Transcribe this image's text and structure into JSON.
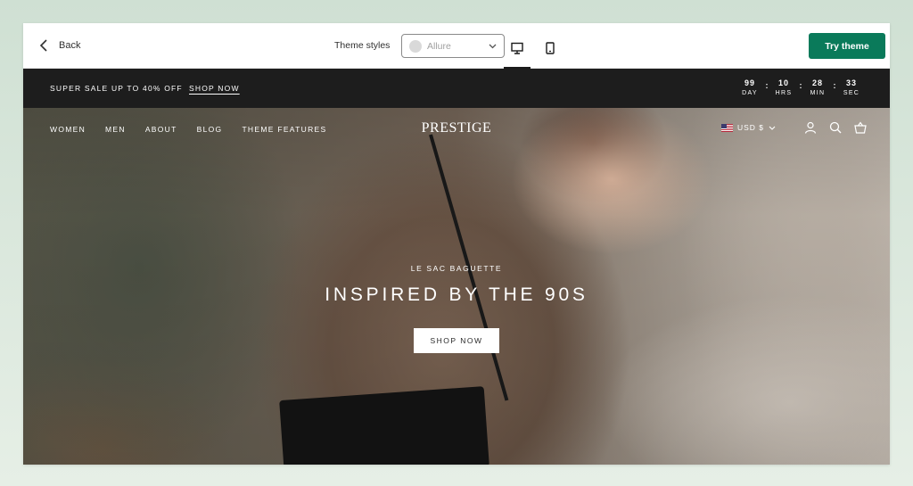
{
  "editor": {
    "back_label": "Back",
    "theme_styles_label": "Theme styles",
    "theme_style_value": "Allure",
    "try_theme_label": "Try theme",
    "accent_color": "#0a7a5a"
  },
  "announcement": {
    "text": "SUPER SALE UP TO 40% OFF",
    "link": "SHOP NOW",
    "countdown": [
      {
        "value": "99",
        "label": "DAY"
      },
      {
        "value": "10",
        "label": "HRS"
      },
      {
        "value": "28",
        "label": "MIN"
      },
      {
        "value": "33",
        "label": "SEC"
      }
    ]
  },
  "store_nav": {
    "items": [
      "WOMEN",
      "MEN",
      "ABOUT",
      "BLOG",
      "THEME FEATURES"
    ],
    "logo": "PRESTIGE",
    "currency": "USD $"
  },
  "hero": {
    "kicker": "LE SAC BAGUETTE",
    "headline": "INSPIRED BY THE 90S",
    "button": "SHOP NOW"
  }
}
